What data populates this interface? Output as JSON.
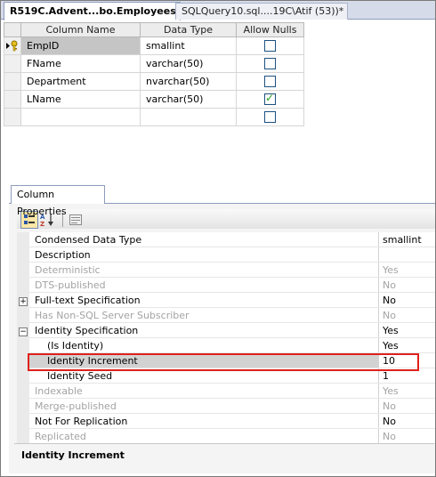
{
  "tabs": {
    "active_label": "R519C.Advent...bo.Employees*",
    "inactive_label": "SQLQuery10.sql....19C\\Atif (53))*"
  },
  "grid": {
    "headers": [
      "Column Name",
      "Data Type",
      "Allow Nulls"
    ],
    "rows": [
      {
        "name": "EmpID",
        "type": "smallint",
        "allow_nulls": false,
        "primary_key": true
      },
      {
        "name": "FName",
        "type": "varchar(50)",
        "allow_nulls": false
      },
      {
        "name": "Department",
        "type": "nvarchar(50)",
        "allow_nulls": false
      },
      {
        "name": "LName",
        "type": "varchar(50)",
        "allow_nulls": true
      },
      {
        "name": "",
        "type": "",
        "allow_nulls": false
      }
    ]
  },
  "panel": {
    "tab_label": "Column Properties",
    "toolbar": {
      "categorized_icon": "categorized-icon",
      "alphabetical_icon": "sort-alphabetical-icon",
      "property_pages_icon": "property-pages-icon"
    },
    "properties": [
      {
        "name": "Condensed Data Type",
        "value": "smallint"
      },
      {
        "name": "Description",
        "value": ""
      },
      {
        "name": "Deterministic",
        "value": "Yes"
      },
      {
        "name": "DTS-published",
        "value": "No"
      },
      {
        "name": "Full-text Specification",
        "value": "No",
        "expander": "+"
      },
      {
        "name": "Has Non-SQL Server Subscriber",
        "value": "No"
      },
      {
        "name": "Identity Specification",
        "value": "Yes",
        "expander": "−"
      },
      {
        "name": "(Is Identity)",
        "value": "Yes"
      },
      {
        "name": "Identity Increment",
        "value": "10"
      },
      {
        "name": "Identity Seed",
        "value": "1"
      },
      {
        "name": "Indexable",
        "value": "Yes"
      },
      {
        "name": "Merge-published",
        "value": "No"
      },
      {
        "name": "Not For Replication",
        "value": "No"
      },
      {
        "name": "Replicated",
        "value": "No"
      }
    ],
    "description_title": "Identity Increment"
  },
  "colors": {
    "highlight_border": "#e0201b",
    "selected_row": "#d2d2d2",
    "checkbox_tick": "#21a121"
  }
}
